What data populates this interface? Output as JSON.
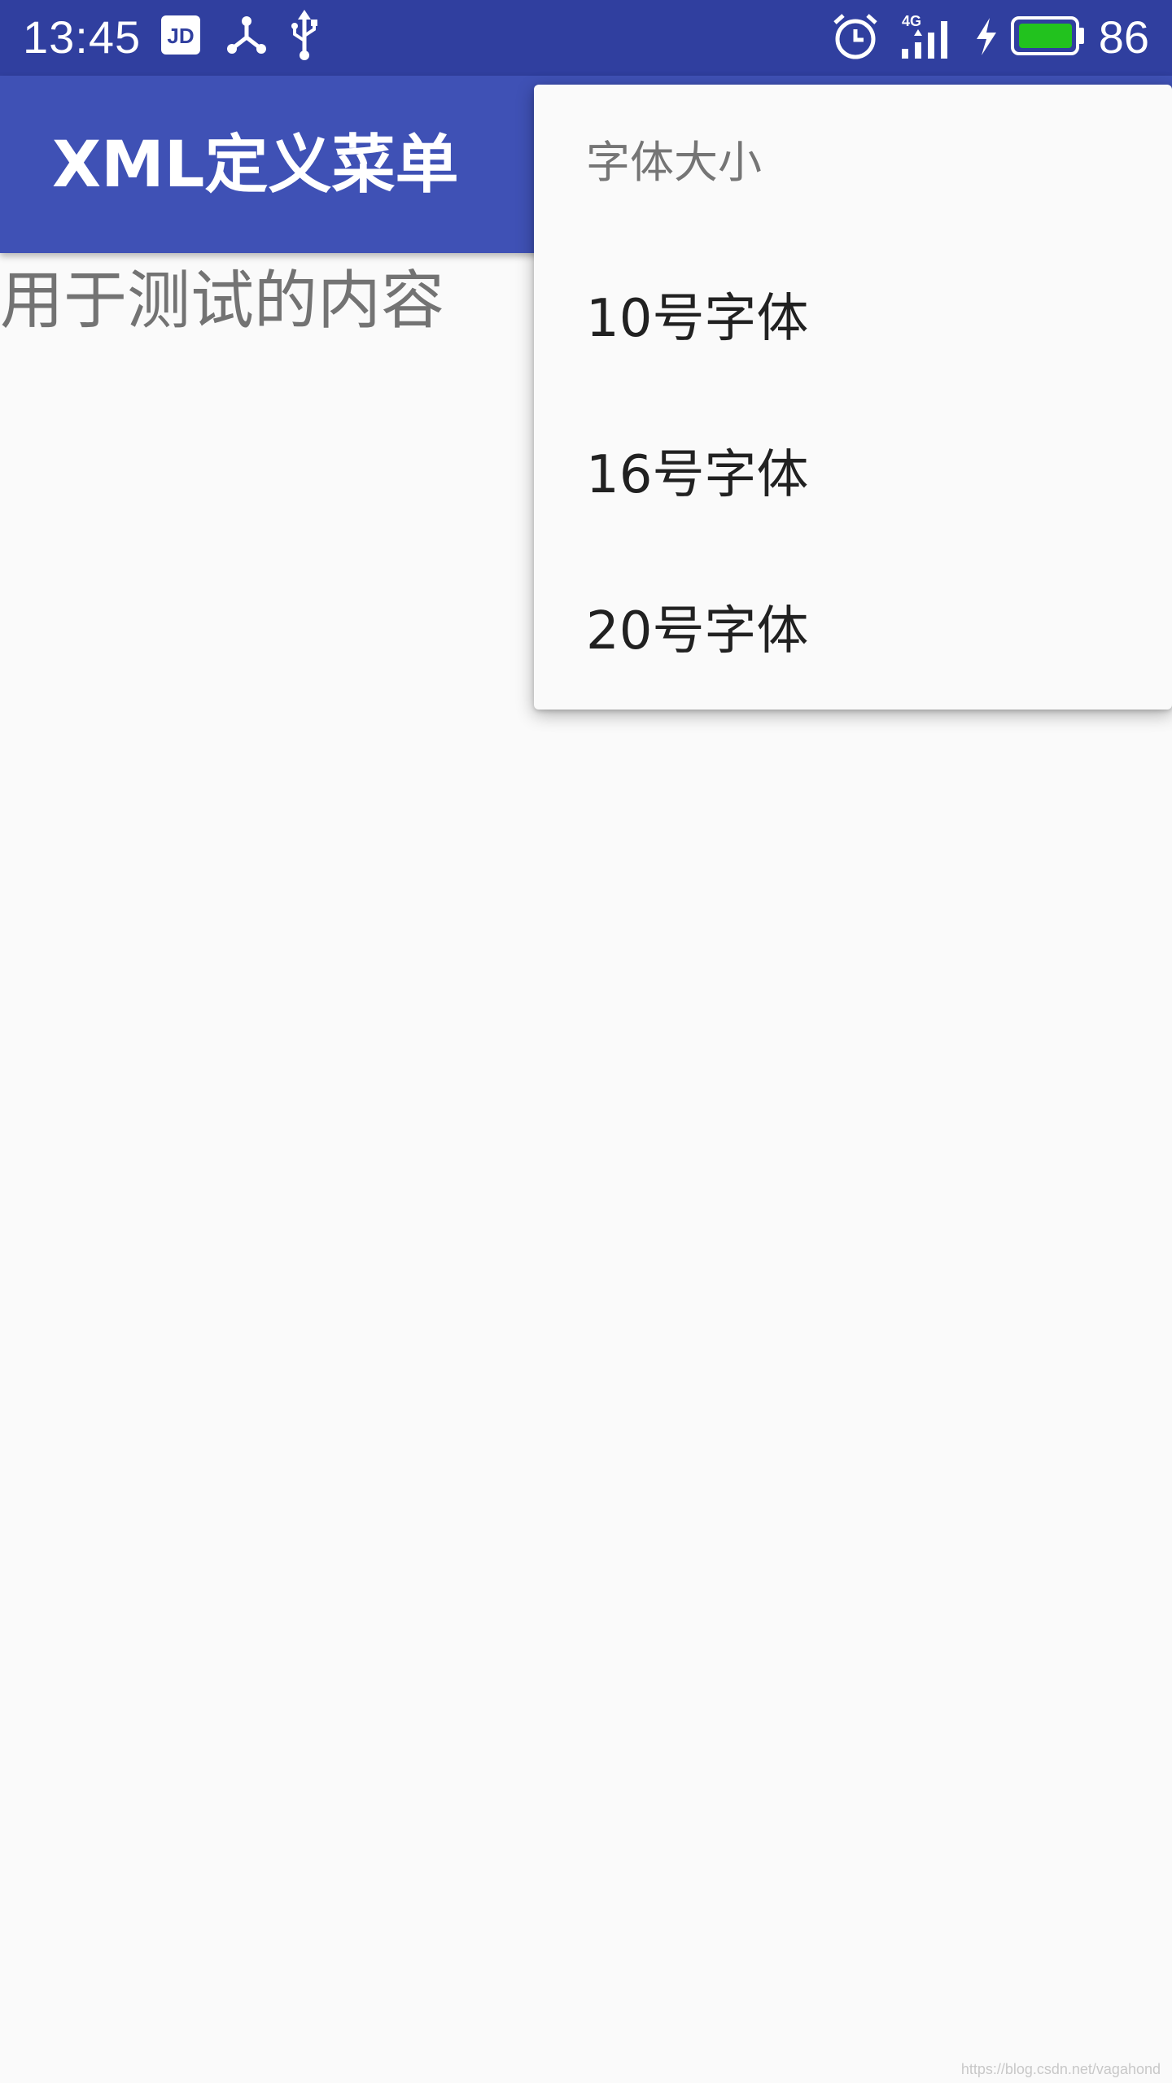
{
  "status_bar": {
    "time": "13:45",
    "icons": [
      "jd-app-icon",
      "share-hub-icon",
      "usb-icon"
    ],
    "right_icons": [
      "alarm-clock-icon",
      "signal-4g-icon",
      "charging-bolt-icon",
      "battery-icon"
    ],
    "network_label": "4G",
    "battery_level": "86",
    "battery_color": "#22c21e"
  },
  "app_bar": {
    "title": "XML定义菜单",
    "color": "#3f51b5"
  },
  "content": {
    "text": "用于测试的内容"
  },
  "popup_menu": {
    "header": "字体大小",
    "items": [
      {
        "label": "10号字体"
      },
      {
        "label": "16号字体"
      },
      {
        "label": "20号字体"
      }
    ]
  },
  "watermark": "https://blog.csdn.net/vagahond"
}
